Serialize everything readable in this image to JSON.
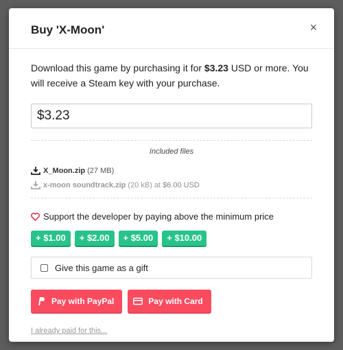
{
  "modal": {
    "title": "Buy 'X-Moon'",
    "close_label": "×",
    "lead_prefix": "Download this game by purchasing it for ",
    "lead_price": "$3.23",
    "lead_suffix": " USD or more. You will receive a Steam key with your purchase.",
    "price_value": "$3.23"
  },
  "files": {
    "heading": "Included files",
    "items": [
      {
        "name": "X_Moon.zip",
        "size": "(27 MB)"
      },
      {
        "name": "x-moon soundtrack.zip",
        "size": "(20 kB)",
        "at": "at",
        "price": "$6.00 USD"
      }
    ]
  },
  "support": {
    "label": "Support the developer by paying above the minimum price",
    "tips": [
      "+ $1.00",
      "+ $2.00",
      "+ $5.00",
      "+ $10.00"
    ],
    "heart_color": "#e03b4f",
    "tip_color": "#28c38a"
  },
  "gift": {
    "label": "Give this game as a gift",
    "checked": false
  },
  "pay": {
    "paypal_label": "Pay with PayPal",
    "card_label": "Pay with Card",
    "color": "#fa4b5f"
  },
  "already_paid": "I already paid for this..."
}
